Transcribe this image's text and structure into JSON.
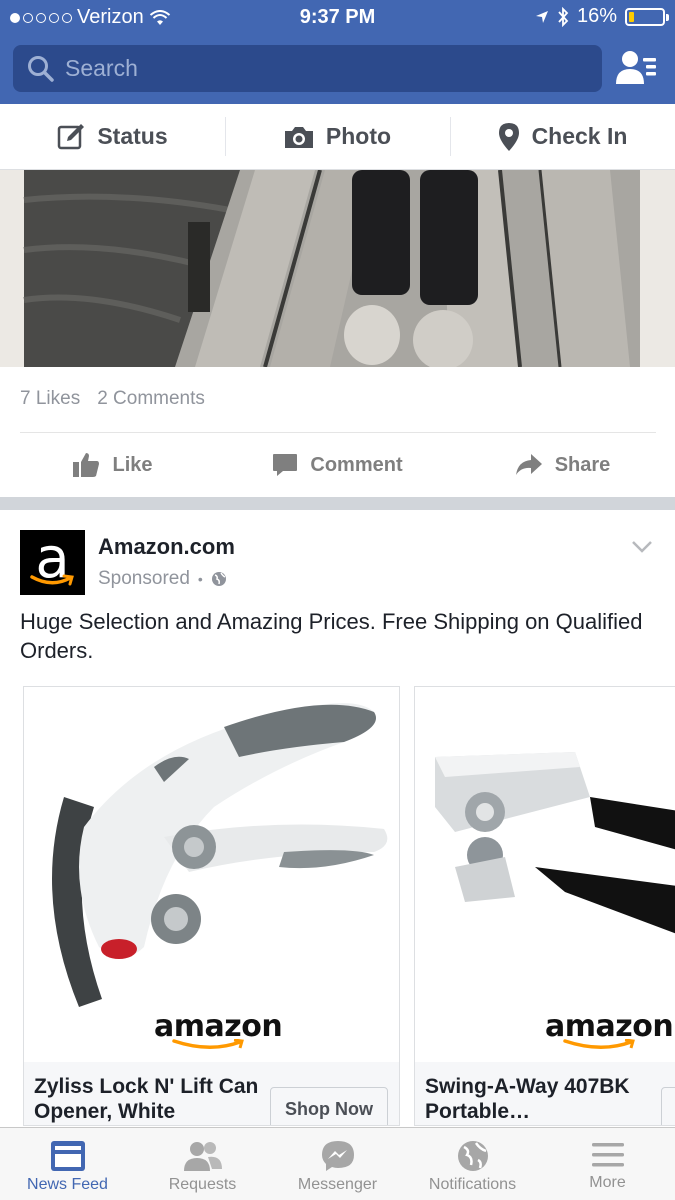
{
  "status_bar": {
    "carrier": "Verizon",
    "time": "9:37 PM",
    "battery": "16%",
    "battery_level": 0.16
  },
  "search": {
    "placeholder": "Search"
  },
  "composer": {
    "status": "Status",
    "photo": "Photo",
    "check_in": "Check In"
  },
  "post": {
    "likes": "7 Likes",
    "comments": "2 Comments",
    "actions": {
      "like": "Like",
      "comment": "Comment",
      "share": "Share"
    }
  },
  "ad": {
    "page_name": "Amazon.com",
    "sponsored": "Sponsored",
    "text": "Huge Selection and Amazing Prices. Free Shipping on Qualified Orders.",
    "cards": [
      {
        "title": "Zyliss Lock N' Lift Can Opener, White",
        "cta": "Shop Now",
        "brand": "amazon"
      },
      {
        "title": "Swing-A-Way 407BK Portable…",
        "brand": "amazon"
      }
    ]
  },
  "tabs": [
    {
      "label": "News Feed",
      "icon": "news-feed-icon",
      "active": true
    },
    {
      "label": "Requests",
      "icon": "requests-icon"
    },
    {
      "label": "Messenger",
      "icon": "messenger-icon"
    },
    {
      "label": "Notifications",
      "icon": "globe-icon"
    },
    {
      "label": "More",
      "icon": "hamburger-icon"
    }
  ],
  "colors": {
    "brand_blue": "#4267b2",
    "search_bg": "#2c4a8c",
    "muted_text": "#90949c"
  }
}
